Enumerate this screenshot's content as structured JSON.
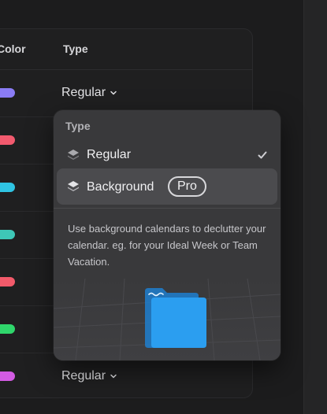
{
  "table": {
    "headers": {
      "color": "Color",
      "type": "Type"
    },
    "rows": [
      {
        "color": "#8a7cf5",
        "type": "Regular"
      },
      {
        "color": "#f25a6e",
        "type": ""
      },
      {
        "color": "#2fc4e3",
        "type": ""
      },
      {
        "color": "#3ec7b7",
        "type": ""
      },
      {
        "color": "#f25a6a",
        "type": ""
      },
      {
        "color": "#2fd66b",
        "type": ""
      },
      {
        "color": "#d35be3",
        "type": "Regular"
      }
    ]
  },
  "dropdown": {
    "title": "Type",
    "options": [
      {
        "label": "Regular",
        "icon": "layers-icon",
        "selected": true
      },
      {
        "label": "Background",
        "icon": "layers-icon",
        "badge": "Pro",
        "highlighted": true
      }
    ],
    "description": "Use background calendars to declutter your calendar. eg. for your Ideal Week or Team Vacation.",
    "illustration": "folder-icon",
    "accent": "#2b9ef0"
  }
}
